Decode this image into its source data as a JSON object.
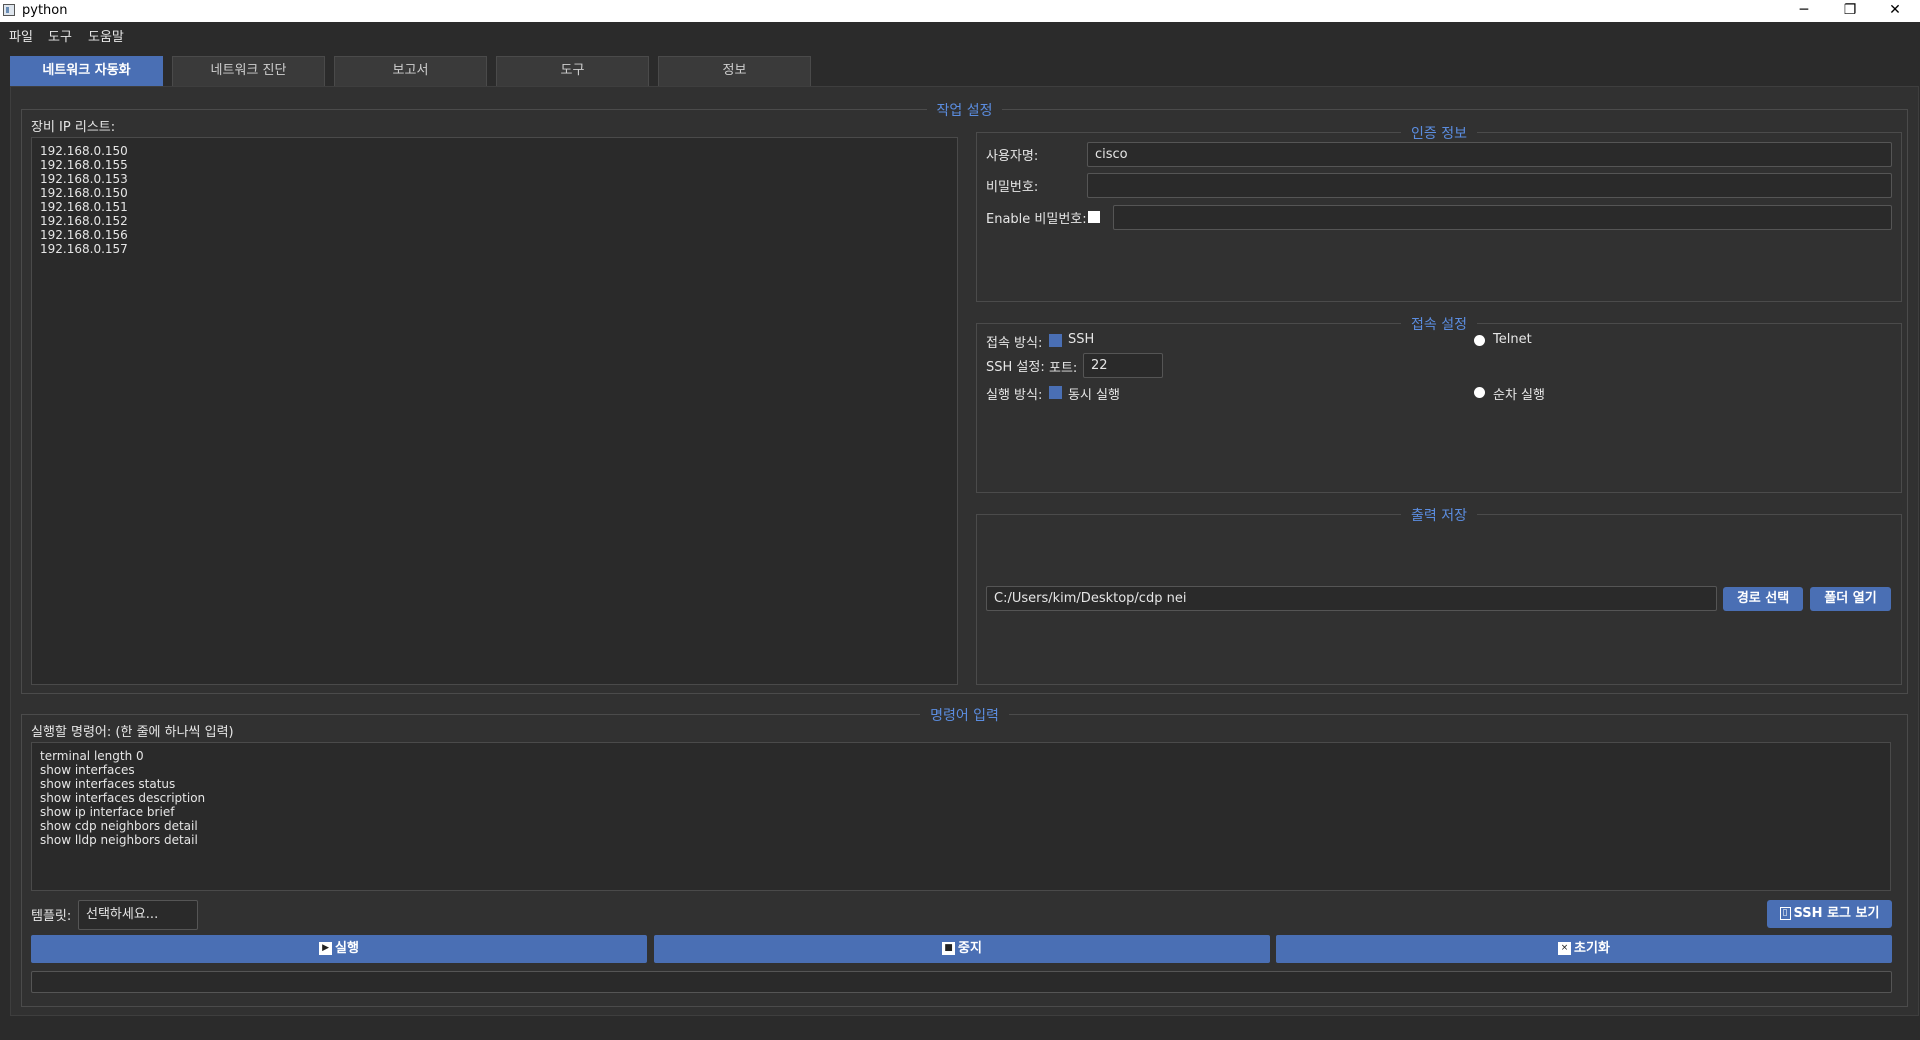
{
  "window": {
    "title": "python",
    "minimize": "─",
    "maximize": "❐",
    "close": "✕"
  },
  "menu": [
    "파일",
    "도구",
    "도움말"
  ],
  "tabs": [
    "네트워크 자동화",
    "네트워크 진단",
    "보고서",
    "도구",
    "정보"
  ],
  "task_settings": {
    "title": "작업 설정",
    "ip_list_label": "장비 IP 리스트:",
    "ip_list": "192.168.0.150\n192.168.0.155\n192.168.0.153\n192.168.0.150\n192.168.0.151\n192.168.0.152\n192.168.0.156\n192.168.0.157"
  },
  "auth": {
    "title": "인증 정보",
    "username_label": "사용자명:",
    "username_value": "cisco",
    "password_label": "비밀번호:",
    "password_value": "",
    "enable_label": "Enable 비밀번호:",
    "enable_value": ""
  },
  "connection": {
    "title": "접속 설정",
    "method_label": "접속 방식:",
    "ssh_option": "SSH",
    "telnet_option": "Telnet",
    "ssh_settings_label": "SSH 설정:",
    "port_label": "포트:",
    "port_value": "22",
    "exec_label": "실행 방식:",
    "concurrent_option": "동시 실행",
    "sequential_option": "순차 실행"
  },
  "output": {
    "title": "출력 저장",
    "path_value": "C:/Users/kim/Desktop/cdp nei",
    "choose_path": "경로 선택",
    "open_folder": "폴더 열기"
  },
  "commands": {
    "title": "명령어 입력",
    "label": "실행할 명령어: (한 줄에 하나씩 입력)",
    "text": "terminal length 0\nshow interfaces\nshow interfaces status\nshow interfaces description\nshow ip interface brief\nshow cdp neighbors detail\nshow lldp neighbors detail",
    "template_label": "템플릿:",
    "template_placeholder": "선택하세요...",
    "ssh_log": "SSH 로그 보기"
  },
  "actions": {
    "run": "실행",
    "stop": "중지",
    "reset": "초기화",
    "run_icon": "▶",
    "stop_icon": "■",
    "reset_icon": "×",
    "log_icon": "▯"
  }
}
